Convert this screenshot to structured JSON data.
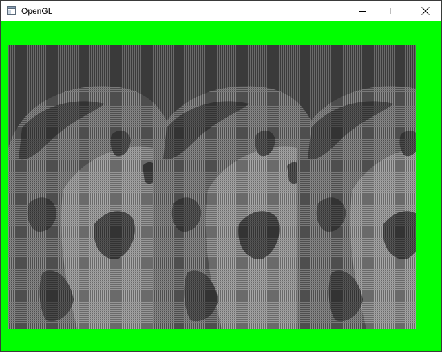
{
  "window": {
    "title": "OpenGL",
    "icon": "application-window-icon",
    "controls": {
      "minimize_icon": "minimize-icon",
      "maximize_icon": "maximize-icon",
      "close_icon": "close-icon"
    }
  },
  "colors": {
    "clear_color": "#00ff00",
    "render_dark": "#3c3c3c",
    "render_light": "#8a8a8a",
    "titlebar": "#ffffff"
  },
  "render": {
    "content": "tiled-texture-rendering",
    "tile_count": 3
  }
}
